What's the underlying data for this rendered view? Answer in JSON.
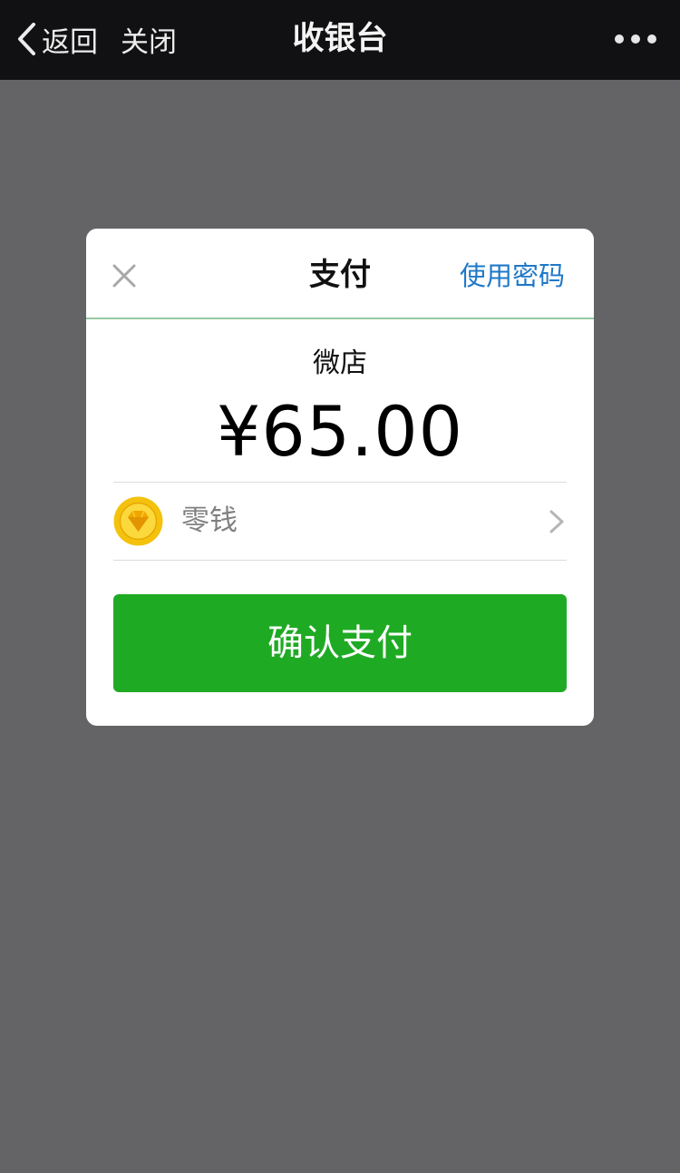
{
  "navbar": {
    "back_label": "返回",
    "close_label": "关闭",
    "title": "收银台"
  },
  "dialog": {
    "title": "支付",
    "use_password_label": "使用密码",
    "merchant": "微店",
    "amount": "¥65.00",
    "payment_method": {
      "label": "零钱",
      "icon": "diamond-coin-icon"
    },
    "confirm_label": "确认支付"
  },
  "colors": {
    "overlay": "#646366",
    "navbar": "#111113",
    "accent_green": "#1faa24",
    "link_blue": "#1f78c8",
    "coin_yellow": "#f4c20d"
  }
}
